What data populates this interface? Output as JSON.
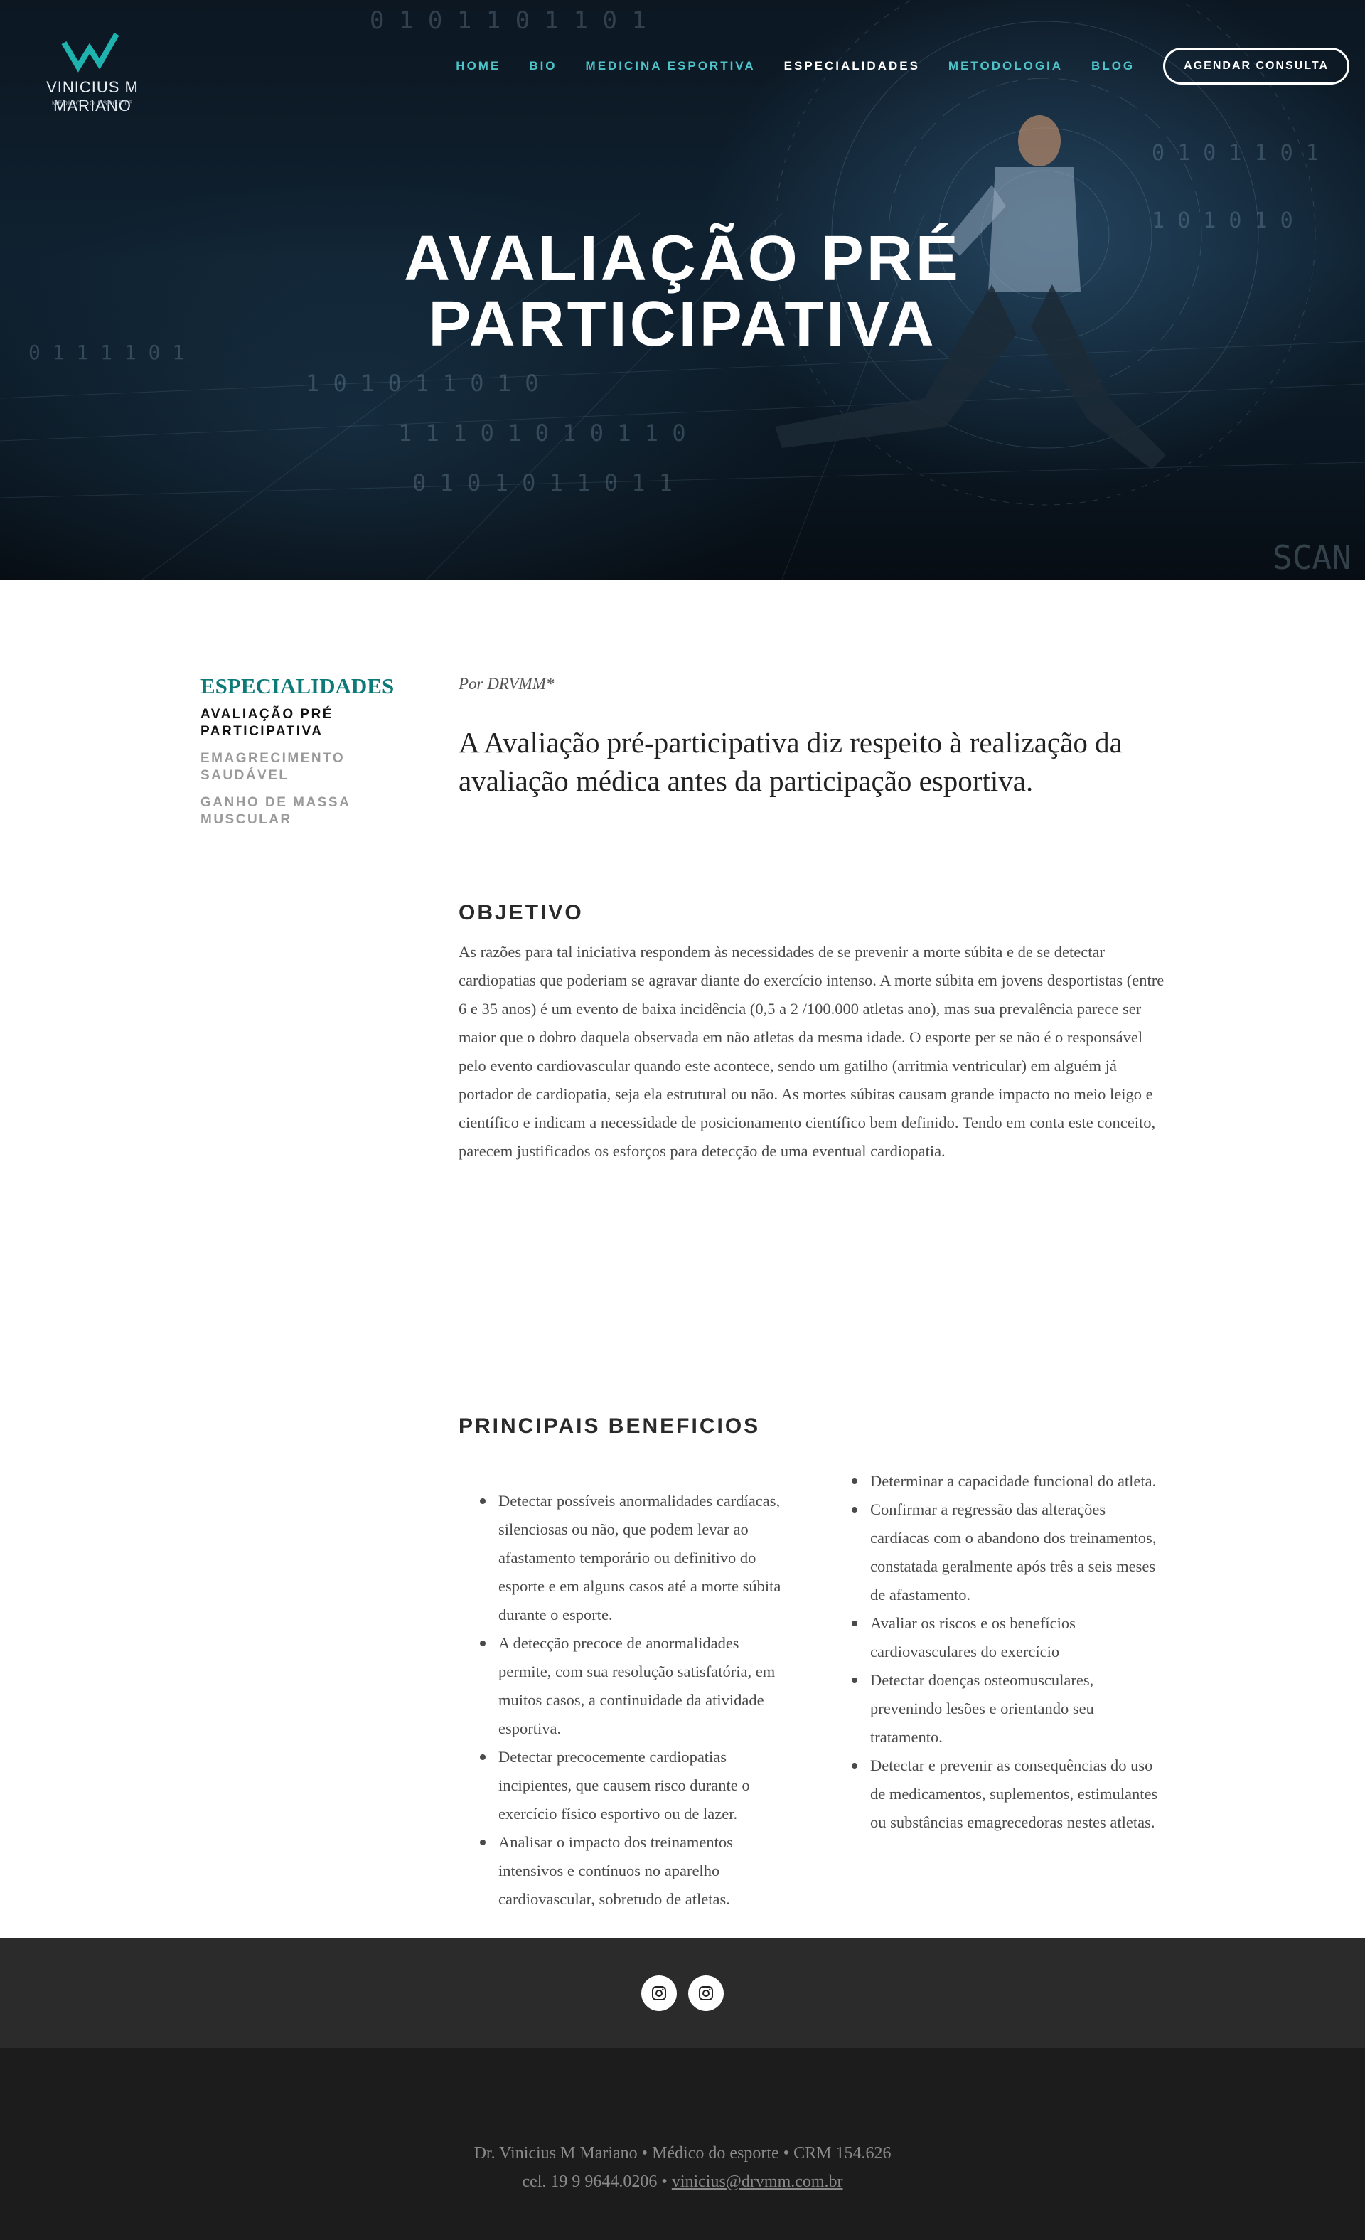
{
  "brand": {
    "name": "VINICIUS M MARIANO",
    "subtitle": "MÉDICO DO ESPORTE",
    "accent": "#4fc3c8"
  },
  "nav": {
    "items": [
      "HOME",
      "BIO",
      "MEDICINA ESPORTIVA",
      "ESPECIALIDADES",
      "METODOLOGIA",
      "BLOG"
    ],
    "active": "ESPECIALIDADES",
    "cta": "AGENDAR CONSULTA"
  },
  "hero": {
    "title_line1": "AVALIAÇÃO PRÉ",
    "title_line2": "PARTICIPATIVA"
  },
  "sidebar": {
    "heading": "ESPECIALIDADES",
    "items": [
      {
        "line1": "AVALIAÇÃO PRÉ",
        "line2": "PARTICIPATIVA",
        "active": true
      },
      {
        "line1": "EMAGRECIMENTO",
        "line2": "SAUDÁVEL",
        "active": false
      },
      {
        "line1": "GANHO DE MASSA",
        "line2": "MUSCULAR",
        "active": false
      }
    ]
  },
  "article": {
    "byline": "Por DRVMM*",
    "lead": "A Avaliação pré-participativa diz respeito à realização da avaliação médica antes da participação esportiva.",
    "objective_title": "OBJETIVO",
    "objective_text": "As razões para tal iniciativa respondem às necessidades de se prevenir a morte súbita e de se detectar cardiopatias que poderiam se agravar diante do exercício intenso. A morte súbita em jovens desportistas (entre 6 e 35 anos) é um evento de baixa incidência (0,5 a 2 /100.000 atletas ano), mas sua prevalência parece ser maior que o dobro daquela observada em não atletas da mesma idade. O esporte per se não é o responsável pelo evento cardiovascular quando este acontece, sendo um gatilho (arritmia ventricular) em alguém já portador de cardiopatia, seja ela estrutural ou não. As mortes súbitas causam grande impacto no meio leigo e científico e indicam a necessidade de posicionamento científico bem definido. Tendo em conta este conceito, parecem justificados os esforços para detecção de uma eventual cardiopatia.",
    "benefits_title": "PRINCIPAIS BENEFICIOS",
    "benefits_left": [
      "Detectar possíveis anormalidades cardíacas, silenciosas ou não, que podem levar ao afastamento temporário ou definitivo do esporte e em alguns casos até a morte súbita durante o esporte.",
      "A detecção precoce de anormalidades permite, com sua resolução satisfatória, em muitos casos, a continuidade da atividade esportiva.",
      "Detectar precocemente cardiopatias incipientes, que causem risco durante o exercício físico esportivo ou de lazer.",
      "Analisar o impacto dos treinamentos intensivos e contínuos no aparelho cardiovascular, sobretudo de atletas."
    ],
    "benefits_right": [
      "Determinar a capacidade funcional do atleta.",
      "Confirmar a regressão das alterações cardíacas com o abandono dos treinamentos, constatada geralmente após três a seis meses de afastamento.",
      "Avaliar os riscos e os benefícios cardiovasculares do exercício",
      "Detectar doenças osteomusculares, prevenindo lesões e orientando seu tratamento.",
      "Detectar e prevenir as consequências do uso de medicamentos, suplementos, estimulantes ou substâncias emagrecedoras nestes atletas."
    ]
  },
  "footer": {
    "social": [
      "instagram-icon",
      "instagram-icon"
    ],
    "line1": "Dr. Vinicius M Mariano • Médico do esporte • CRM 154.626",
    "phone": "cel. 19 9 9644.0206 • ",
    "email": "vinicius@drvmm.com.br"
  }
}
